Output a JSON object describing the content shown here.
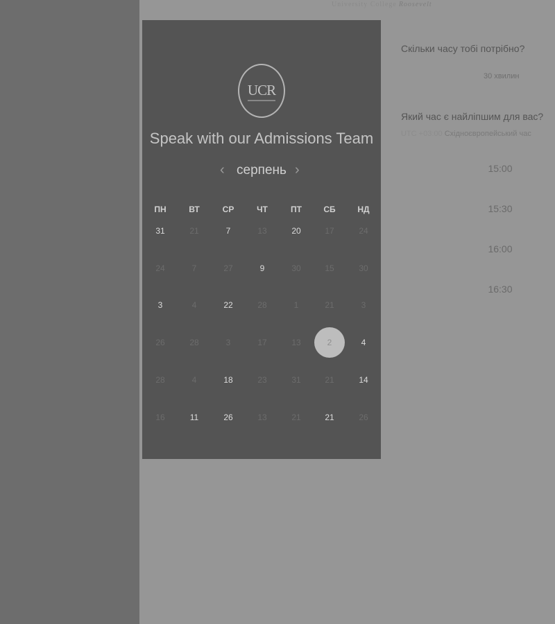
{
  "brand": {
    "line_a": "University College",
    "line_b": "Roosevelt"
  },
  "panel": {
    "logo_text": "UCR",
    "title": "Speak with our Admissions Team",
    "month": "серпень",
    "prev_icon": "chevron-left-icon",
    "next_icon": "chevron-right-icon",
    "weekdays": [
      "ПН",
      "ВТ",
      "СР",
      "ЧТ",
      "ПТ",
      "СБ",
      "НД"
    ],
    "weeks": [
      [
        "31",
        "21",
        "7",
        "13",
        "20",
        "17",
        "24"
      ],
      [
        "24",
        "7",
        "27",
        "9",
        "30",
        "15",
        "30"
      ],
      [
        "3",
        "4",
        "22",
        "28",
        "1",
        "21",
        "3"
      ],
      [
        "26",
        "28",
        "3",
        "17",
        "13",
        "2",
        "4"
      ],
      [
        "28",
        "4",
        "18",
        "23",
        "31",
        "21",
        "14"
      ],
      [
        "16",
        "11",
        "26",
        "13",
        "21",
        "21",
        "26"
      ]
    ],
    "available": [
      [
        true,
        false,
        true,
        false,
        true,
        false,
        false
      ],
      [
        false,
        false,
        false,
        true,
        false,
        false,
        false
      ],
      [
        true,
        false,
        true,
        false,
        false,
        false,
        false
      ],
      [
        false,
        false,
        false,
        false,
        false,
        false,
        true
      ],
      [
        false,
        false,
        true,
        false,
        false,
        false,
        true
      ],
      [
        false,
        true,
        true,
        false,
        false,
        true,
        false
      ]
    ],
    "selected": {
      "week": 3,
      "day": 5
    }
  },
  "right": {
    "duration_question": "Скільки часу тобі потрібно?",
    "duration_value": "30 хвилин",
    "time_question": "Який час є найліпшим для вас?",
    "timezone_offset": "UTC +03:00",
    "timezone_name": "Східноєвропейський час",
    "time_slots": [
      "15:00",
      "15:30",
      "16:00",
      "16:30"
    ]
  },
  "colors": {
    "left_rail": "#6d6d6d",
    "panel": "#545454",
    "background": "#969696",
    "selected_day": "#bdbdbd"
  }
}
